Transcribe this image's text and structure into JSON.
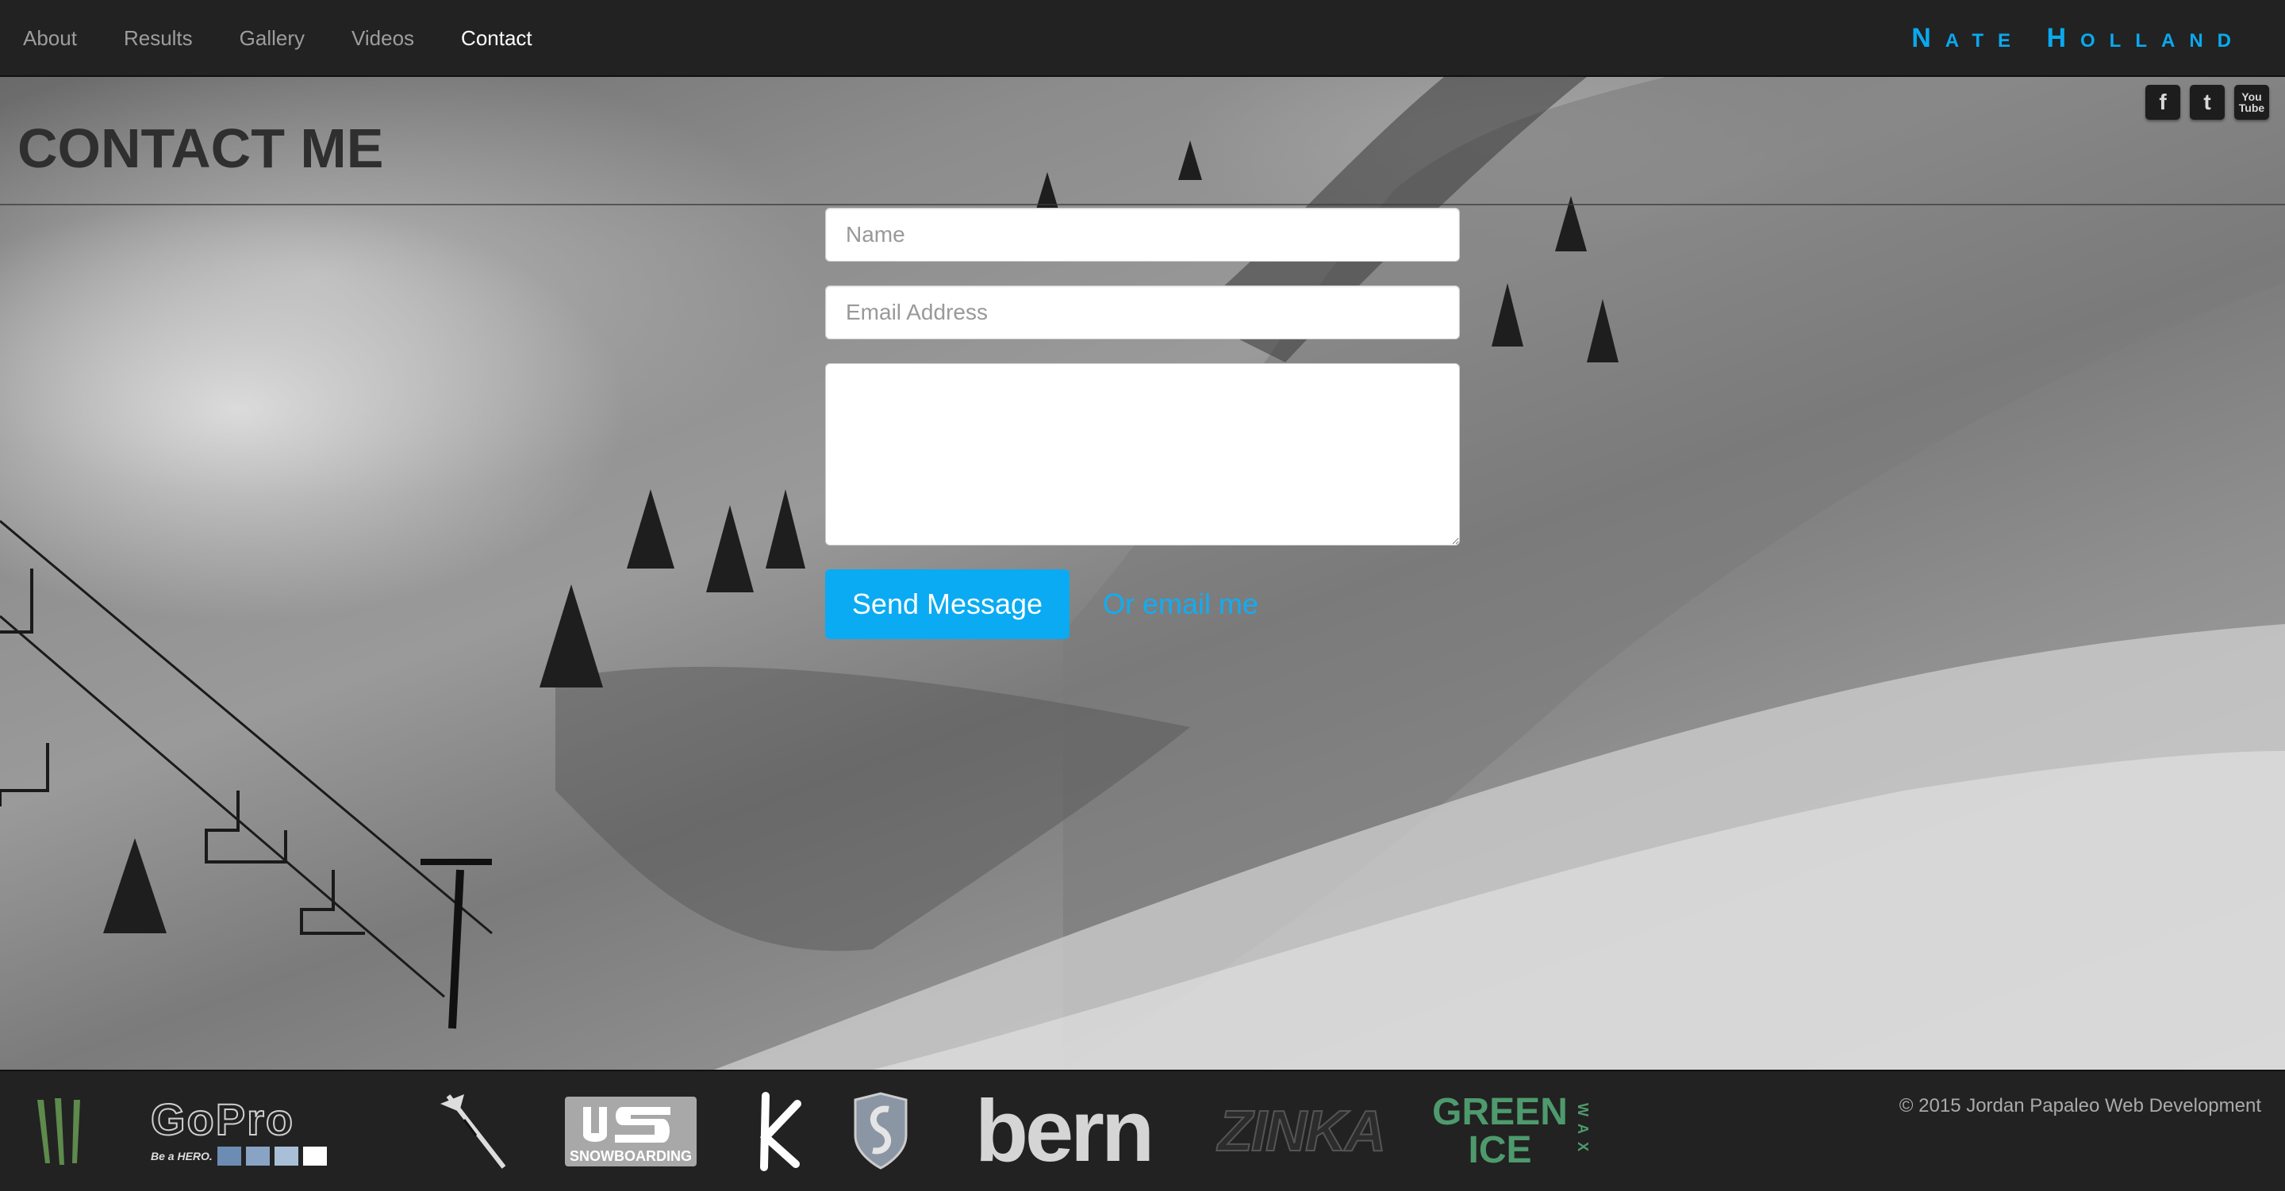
{
  "nav": {
    "items": [
      {
        "label": "About"
      },
      {
        "label": "Results"
      },
      {
        "label": "Gallery"
      },
      {
        "label": "Videos"
      },
      {
        "label": "Contact",
        "active": true
      }
    ],
    "brand": "Nate Holland",
    "brand_color": "#0aa9ef"
  },
  "page": {
    "title": "CONTACT ME"
  },
  "social": {
    "facebook": "f",
    "twitter": "t",
    "youtube": "You Tube"
  },
  "form": {
    "name_placeholder": "Name",
    "email_placeholder": "Email Address",
    "message_placeholder": "",
    "send_label": "Send Message",
    "alt_link_label": "Or email me",
    "accent_color": "#0aabf2"
  },
  "footer": {
    "sponsors": [
      {
        "name": "monster-energy-logo"
      },
      {
        "name": "gopro-logo",
        "text": "GoPro",
        "tagline": "Be a HERO."
      },
      {
        "name": "tomahawk-logo"
      },
      {
        "name": "us-snowboarding-logo",
        "text": "SNOWBOARDING"
      },
      {
        "name": "k-logo"
      },
      {
        "name": "shield-s-logo"
      },
      {
        "name": "bern-logo",
        "text": "bern"
      },
      {
        "name": "zinka-logo",
        "text": "ZINKA"
      },
      {
        "name": "green-ice-wax-logo",
        "text_line1": "GREEN",
        "text_line2": "ICE",
        "side_text": "WAX"
      }
    ],
    "copyright": "© 2015 Jordan Papaleo Web Development"
  }
}
